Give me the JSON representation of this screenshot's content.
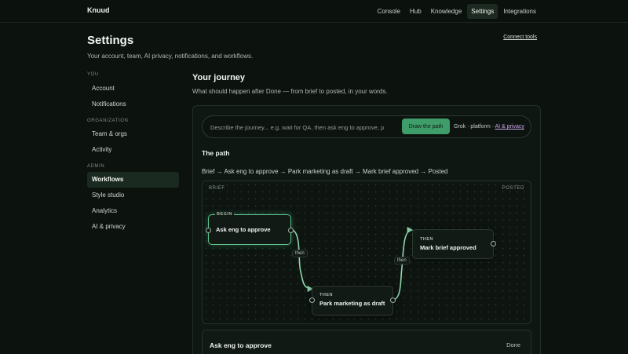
{
  "app": {
    "brand": "Knuud"
  },
  "nav": {
    "items": [
      {
        "label": "Console"
      },
      {
        "label": "Hub"
      },
      {
        "label": "Knowledge"
      },
      {
        "label": "Settings",
        "active": true
      },
      {
        "label": "Integrations"
      }
    ]
  },
  "header": {
    "title": "Settings",
    "subtitle": "Your account, team, AI privacy, notifications, and workflows.",
    "connect_tools": "Connect tools"
  },
  "sidebar": {
    "groups": [
      {
        "label": "YOU",
        "items": [
          "Account",
          "Notifications"
        ]
      },
      {
        "label": "ORGANIZATION",
        "items": [
          "Team & orgs",
          "Activity"
        ]
      },
      {
        "label": "ADMIN",
        "items": [
          "Workflows",
          "Style studio",
          "Analytics",
          "AI & privacy"
        ]
      }
    ],
    "active_item": "Workflows"
  },
  "main": {
    "title": "Your journey",
    "subtitle": "What should happen after Done — from brief to posted, in your words.",
    "prompt": {
      "placeholder": "Describe the journey... e.g. wait for QA, then ask eng to approve, p",
      "value": "",
      "button_label": "Draw the path",
      "meta_prefix": "Grok · platform · ",
      "meta_link": "AI & privacy"
    },
    "path_title": "The path",
    "path_summary": "Brief → Ask eng to approve → Park marketing as draft → Mark brief approved → Posted",
    "canvas": {
      "start_label": "BRIEF",
      "end_label": "POSTED",
      "nodes": [
        {
          "tag": "BEGIN",
          "label": "Ask eng to approve"
        },
        {
          "tag": "THEN",
          "label": "Park marketing as draft"
        },
        {
          "tag": "THEN",
          "label": "Mark brief approved"
        }
      ],
      "edges": [
        {
          "label": "then"
        },
        {
          "label": "then"
        }
      ]
    },
    "step": {
      "title": "Ask eng to approve",
      "status": "Done"
    }
  },
  "colors": {
    "background": "#0c120e",
    "accent": "#3f9d6a",
    "begin_border": "#5fc28e",
    "link": "#c7a4e8"
  }
}
